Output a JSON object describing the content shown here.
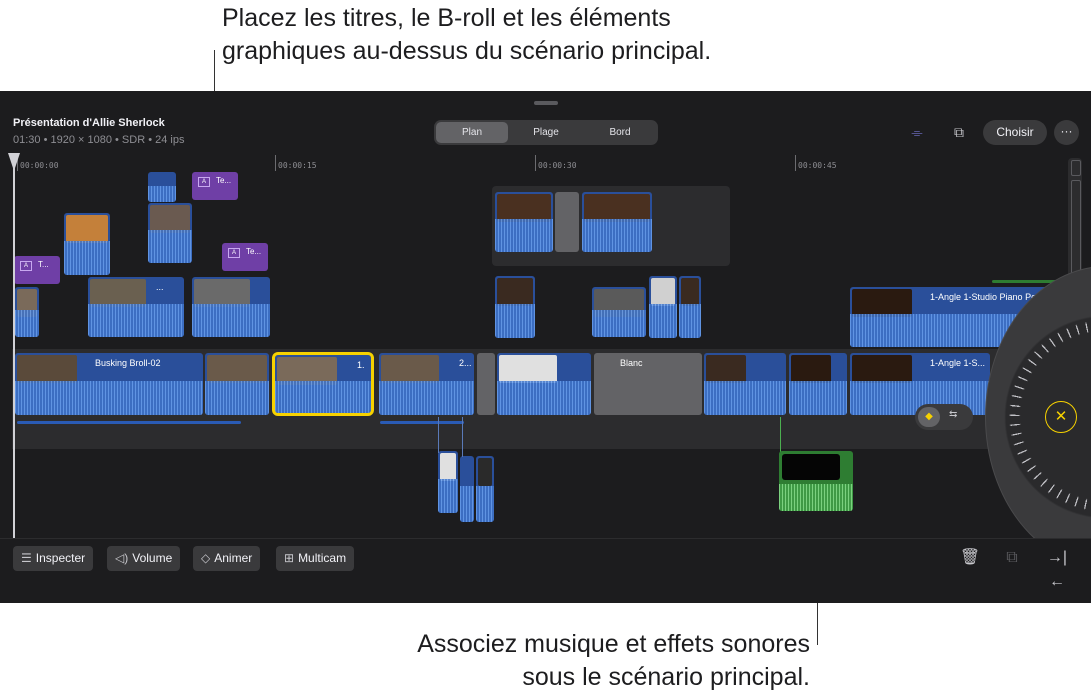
{
  "callouts": {
    "top_line1": "Placez les titres, le B-roll et les éléments",
    "top_line2": "graphiques au-dessus du scénario principal.",
    "bottom_line1": "Associez musique et effets sonores",
    "bottom_line2": "sous le scénario principal."
  },
  "project": {
    "title": "Présentation d'Allie Sherlock",
    "meta": "01:30 • 1920 × 1080 • SDR • 24 ips"
  },
  "view_mode": {
    "options": [
      "Plan",
      "Plage",
      "Bord"
    ],
    "selected": "Plan"
  },
  "toolbar": {
    "choose_label": "Choisir",
    "more_label": "···",
    "icons": [
      "snapping-icon",
      "skimming-icon"
    ]
  },
  "ruler": {
    "labels": [
      "00:00:00",
      "00:00:15",
      "00:00:30",
      "00:00:45"
    ]
  },
  "clips": {
    "primary_1": "Busking Broll-02",
    "primary_sel": "1.",
    "primary_4": "2...",
    "blank": "Blanc",
    "angle_upper": "1-Angle 1-Studio Piano Pe...",
    "angle_primary": "1-Angle 1-S...",
    "title_1": "T...",
    "title_2": "Te...",
    "title_3": "Te...",
    "broll_mid": "..."
  },
  "bottom_bar": {
    "inspect": "Inspecter",
    "volume": "Volume",
    "animate": "Animer",
    "multicam": "Multicam"
  },
  "jog_wheel": {
    "close_symbol": "✕"
  },
  "colors": {
    "video_clip": "#2a4f9a",
    "title_clip": "#6f3fa6",
    "audio_clip": "#2e7d32",
    "selection": "#f7d200",
    "background": "#1c1c1e"
  }
}
